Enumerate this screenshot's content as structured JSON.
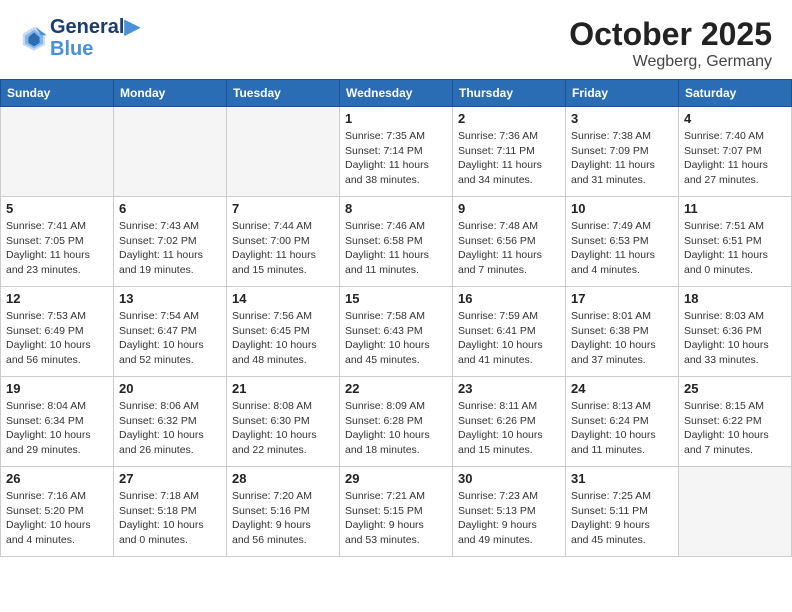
{
  "header": {
    "logo_line1": "General",
    "logo_line2": "Blue",
    "month_title": "October 2025",
    "location": "Wegberg, Germany"
  },
  "weekdays": [
    "Sunday",
    "Monday",
    "Tuesday",
    "Wednesday",
    "Thursday",
    "Friday",
    "Saturday"
  ],
  "weeks": [
    [
      {
        "day": "",
        "info": ""
      },
      {
        "day": "",
        "info": ""
      },
      {
        "day": "",
        "info": ""
      },
      {
        "day": "1",
        "info": "Sunrise: 7:35 AM\nSunset: 7:14 PM\nDaylight: 11 hours\nand 38 minutes."
      },
      {
        "day": "2",
        "info": "Sunrise: 7:36 AM\nSunset: 7:11 PM\nDaylight: 11 hours\nand 34 minutes."
      },
      {
        "day": "3",
        "info": "Sunrise: 7:38 AM\nSunset: 7:09 PM\nDaylight: 11 hours\nand 31 minutes."
      },
      {
        "day": "4",
        "info": "Sunrise: 7:40 AM\nSunset: 7:07 PM\nDaylight: 11 hours\nand 27 minutes."
      }
    ],
    [
      {
        "day": "5",
        "info": "Sunrise: 7:41 AM\nSunset: 7:05 PM\nDaylight: 11 hours\nand 23 minutes."
      },
      {
        "day": "6",
        "info": "Sunrise: 7:43 AM\nSunset: 7:02 PM\nDaylight: 11 hours\nand 19 minutes."
      },
      {
        "day": "7",
        "info": "Sunrise: 7:44 AM\nSunset: 7:00 PM\nDaylight: 11 hours\nand 15 minutes."
      },
      {
        "day": "8",
        "info": "Sunrise: 7:46 AM\nSunset: 6:58 PM\nDaylight: 11 hours\nand 11 minutes."
      },
      {
        "day": "9",
        "info": "Sunrise: 7:48 AM\nSunset: 6:56 PM\nDaylight: 11 hours\nand 7 minutes."
      },
      {
        "day": "10",
        "info": "Sunrise: 7:49 AM\nSunset: 6:53 PM\nDaylight: 11 hours\nand 4 minutes."
      },
      {
        "day": "11",
        "info": "Sunrise: 7:51 AM\nSunset: 6:51 PM\nDaylight: 11 hours\nand 0 minutes."
      }
    ],
    [
      {
        "day": "12",
        "info": "Sunrise: 7:53 AM\nSunset: 6:49 PM\nDaylight: 10 hours\nand 56 minutes."
      },
      {
        "day": "13",
        "info": "Sunrise: 7:54 AM\nSunset: 6:47 PM\nDaylight: 10 hours\nand 52 minutes."
      },
      {
        "day": "14",
        "info": "Sunrise: 7:56 AM\nSunset: 6:45 PM\nDaylight: 10 hours\nand 48 minutes."
      },
      {
        "day": "15",
        "info": "Sunrise: 7:58 AM\nSunset: 6:43 PM\nDaylight: 10 hours\nand 45 minutes."
      },
      {
        "day": "16",
        "info": "Sunrise: 7:59 AM\nSunset: 6:41 PM\nDaylight: 10 hours\nand 41 minutes."
      },
      {
        "day": "17",
        "info": "Sunrise: 8:01 AM\nSunset: 6:38 PM\nDaylight: 10 hours\nand 37 minutes."
      },
      {
        "day": "18",
        "info": "Sunrise: 8:03 AM\nSunset: 6:36 PM\nDaylight: 10 hours\nand 33 minutes."
      }
    ],
    [
      {
        "day": "19",
        "info": "Sunrise: 8:04 AM\nSunset: 6:34 PM\nDaylight: 10 hours\nand 29 minutes."
      },
      {
        "day": "20",
        "info": "Sunrise: 8:06 AM\nSunset: 6:32 PM\nDaylight: 10 hours\nand 26 minutes."
      },
      {
        "day": "21",
        "info": "Sunrise: 8:08 AM\nSunset: 6:30 PM\nDaylight: 10 hours\nand 22 minutes."
      },
      {
        "day": "22",
        "info": "Sunrise: 8:09 AM\nSunset: 6:28 PM\nDaylight: 10 hours\nand 18 minutes."
      },
      {
        "day": "23",
        "info": "Sunrise: 8:11 AM\nSunset: 6:26 PM\nDaylight: 10 hours\nand 15 minutes."
      },
      {
        "day": "24",
        "info": "Sunrise: 8:13 AM\nSunset: 6:24 PM\nDaylight: 10 hours\nand 11 minutes."
      },
      {
        "day": "25",
        "info": "Sunrise: 8:15 AM\nSunset: 6:22 PM\nDaylight: 10 hours\nand 7 minutes."
      }
    ],
    [
      {
        "day": "26",
        "info": "Sunrise: 7:16 AM\nSunset: 5:20 PM\nDaylight: 10 hours\nand 4 minutes."
      },
      {
        "day": "27",
        "info": "Sunrise: 7:18 AM\nSunset: 5:18 PM\nDaylight: 10 hours\nand 0 minutes."
      },
      {
        "day": "28",
        "info": "Sunrise: 7:20 AM\nSunset: 5:16 PM\nDaylight: 9 hours\nand 56 minutes."
      },
      {
        "day": "29",
        "info": "Sunrise: 7:21 AM\nSunset: 5:15 PM\nDaylight: 9 hours\nand 53 minutes."
      },
      {
        "day": "30",
        "info": "Sunrise: 7:23 AM\nSunset: 5:13 PM\nDaylight: 9 hours\nand 49 minutes."
      },
      {
        "day": "31",
        "info": "Sunrise: 7:25 AM\nSunset: 5:11 PM\nDaylight: 9 hours\nand 45 minutes."
      },
      {
        "day": "",
        "info": ""
      }
    ]
  ]
}
